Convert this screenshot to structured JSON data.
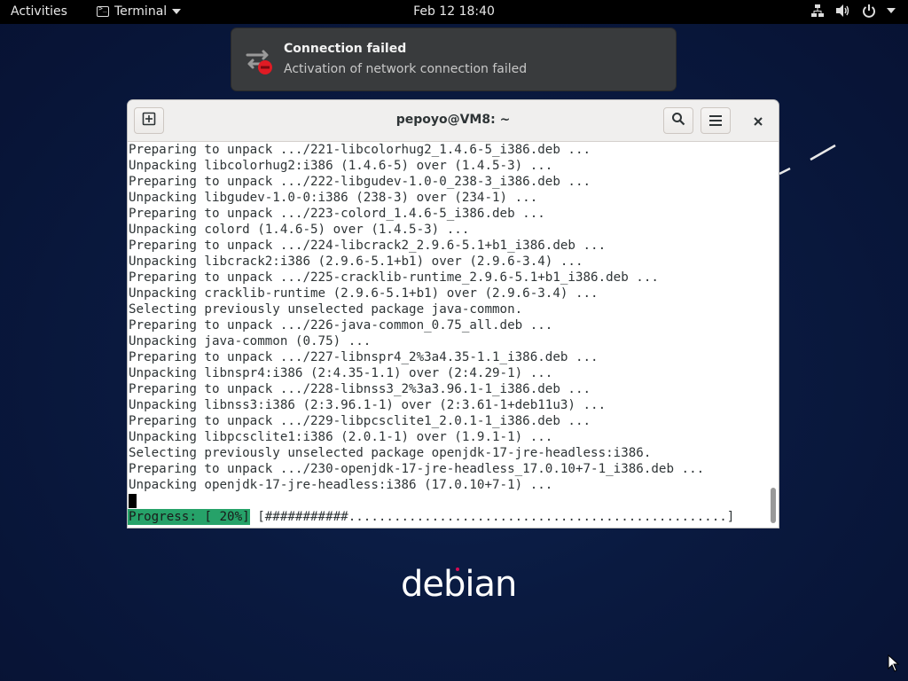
{
  "topbar": {
    "activities_label": "Activities",
    "app_name": "Terminal",
    "clock": "Feb 12  18:40"
  },
  "notification": {
    "title": "Connection failed",
    "body": "Activation of network connection failed"
  },
  "terminal": {
    "title": "pepoyo@VM8: ~",
    "lines": [
      "Preparing to unpack .../221-libcolorhug2_1.4.6-5_i386.deb ...",
      "Unpacking libcolorhug2:i386 (1.4.6-5) over (1.4.5-3) ...",
      "Preparing to unpack .../222-libgudev-1.0-0_238-3_i386.deb ...",
      "Unpacking libgudev-1.0-0:i386 (238-3) over (234-1) ...",
      "Preparing to unpack .../223-colord_1.4.6-5_i386.deb ...",
      "Unpacking colord (1.4.6-5) over (1.4.5-3) ...",
      "Preparing to unpack .../224-libcrack2_2.9.6-5.1+b1_i386.deb ...",
      "Unpacking libcrack2:i386 (2.9.6-5.1+b1) over (2.9.6-3.4) ...",
      "Preparing to unpack .../225-cracklib-runtime_2.9.6-5.1+b1_i386.deb ...",
      "Unpacking cracklib-runtime (2.9.6-5.1+b1) over (2.9.6-3.4) ...",
      "Selecting previously unselected package java-common.",
      "Preparing to unpack .../226-java-common_0.75_all.deb ...",
      "Unpacking java-common (0.75) ...",
      "Preparing to unpack .../227-libnspr4_2%3a4.35-1.1_i386.deb ...",
      "Unpacking libnspr4:i386 (2:4.35-1.1) over (2:4.29-1) ...",
      "Preparing to unpack .../228-libnss3_2%3a3.96.1-1_i386.deb ...",
      "Unpacking libnss3:i386 (2:3.96.1-1) over (2:3.61-1+deb11u3) ...",
      "Preparing to unpack .../229-libpcsclite1_2.0.1-1_i386.deb ...",
      "Unpacking libpcsclite1:i386 (2.0.1-1) over (1.9.1-1) ...",
      "Selecting previously unselected package openjdk-17-jre-headless:i386.",
      "Preparing to unpack .../230-openjdk-17-jre-headless_17.0.10+7-1_i386.deb ...",
      "Unpacking openjdk-17-jre-headless:i386 (17.0.10+7-1) ..."
    ],
    "progress_label": "Progress: [ 20%]",
    "progress_bar": " [###########..................................................]"
  },
  "desktop": {
    "logo_text": "debian"
  },
  "icons": {
    "terminal_app": "terminal-icon",
    "network": "network-icon",
    "volume": "volume-icon",
    "power": "power-icon",
    "new_tab": "new-tab-icon",
    "search": "search-icon",
    "menu": "hamburger-menu-icon",
    "close": "close-icon",
    "notification": "network-error-icon"
  },
  "colors": {
    "progress_highlight": "#26a269",
    "desktop_background": "#0a1a40",
    "topbar": "#000000",
    "notification_bg": "#393b3d",
    "error_red": "#e01b24"
  }
}
